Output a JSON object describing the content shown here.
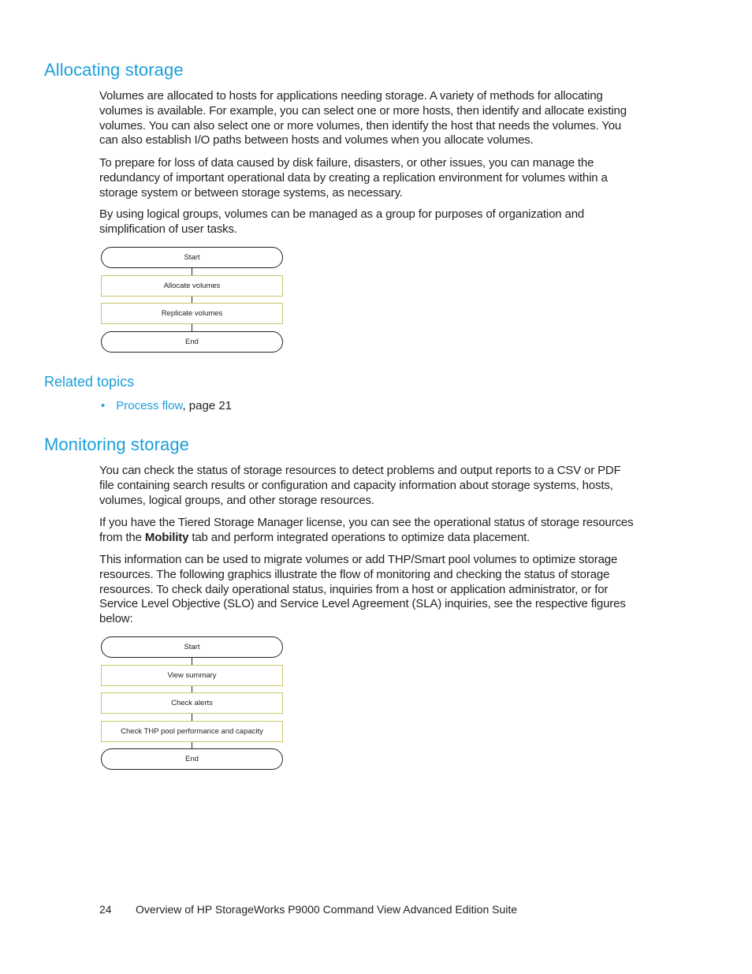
{
  "sections": {
    "allocating": {
      "title": "Allocating storage",
      "paragraphs": [
        "Volumes are allocated to hosts for applications needing storage. A variety of methods for allocating volumes is available. For example, you can select one or more hosts, then identify and allocate existing volumes. You can also select one or more volumes, then identify the host that needs the volumes. You can also establish I/O paths between hosts and volumes when you allocate volumes.",
        "To prepare for loss of data caused by disk failure, disasters, or other issues, you can manage the redundancy of important operational data by creating a replication environment for volumes within a storage system or between storage systems, as necessary.",
        "By using logical groups, volumes can be managed as a group for purposes of organization and simplification of user tasks."
      ],
      "flow": [
        "Start",
        "Allocate volumes",
        "Replicate volumes",
        "End"
      ]
    },
    "related": {
      "title": "Related topics",
      "items": [
        {
          "link": "Process flow",
          "suffix": ", page 21"
        }
      ]
    },
    "monitoring": {
      "title": "Monitoring storage",
      "para1": "You can check the status of storage resources to detect problems and output reports to a CSV or PDF file containing search results or configuration and capacity information about storage systems, hosts, volumes, logical groups, and other storage resources.",
      "para2_before": "If you have the Tiered Storage Manager license, you can see the operational status of storage resources from the ",
      "para2_bold": "Mobility",
      "para2_after": " tab and perform integrated operations to optimize data placement.",
      "para3": "This information can be used to migrate volumes or add THP/Smart pool volumes to optimize storage resources. The following graphics illustrate the flow of monitoring and checking the status of storage resources. To check daily operational status, inquiries from a host or application administrator, or for Service Level Objective (SLO) and Service Level Agreement (SLA) inquiries, see the respective figures below:",
      "flow": [
        "Start",
        "View summary",
        "Check alerts",
        "Check THP pool performance and capacity",
        "End"
      ]
    }
  },
  "footer": {
    "page_number": "24",
    "title": "Overview of HP StorageWorks P9000 Command View Advanced Edition Suite"
  },
  "colors": {
    "heading": "#1a9fd9",
    "link": "#1a9fd9",
    "process_border": "#c9c76a"
  }
}
